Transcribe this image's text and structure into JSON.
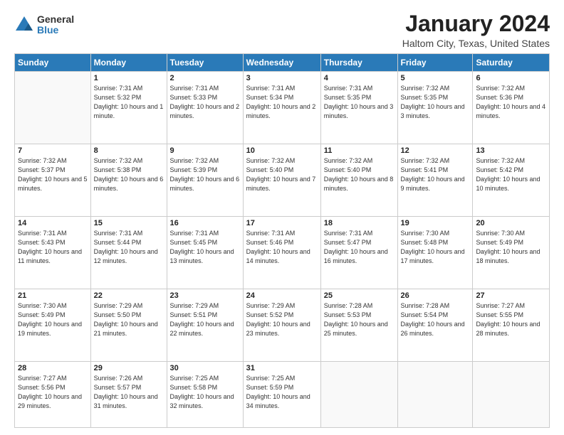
{
  "logo": {
    "general": "General",
    "blue": "Blue"
  },
  "header": {
    "month": "January 2024",
    "location": "Haltom City, Texas, United States"
  },
  "days_of_week": [
    "Sunday",
    "Monday",
    "Tuesday",
    "Wednesday",
    "Thursday",
    "Friday",
    "Saturday"
  ],
  "weeks": [
    [
      {
        "day": "",
        "info": ""
      },
      {
        "day": "1",
        "info": "Sunrise: 7:31 AM\nSunset: 5:32 PM\nDaylight: 10 hours\nand 1 minute."
      },
      {
        "day": "2",
        "info": "Sunrise: 7:31 AM\nSunset: 5:33 PM\nDaylight: 10 hours\nand 2 minutes."
      },
      {
        "day": "3",
        "info": "Sunrise: 7:31 AM\nSunset: 5:34 PM\nDaylight: 10 hours\nand 2 minutes."
      },
      {
        "day": "4",
        "info": "Sunrise: 7:31 AM\nSunset: 5:35 PM\nDaylight: 10 hours\nand 3 minutes."
      },
      {
        "day": "5",
        "info": "Sunrise: 7:32 AM\nSunset: 5:35 PM\nDaylight: 10 hours\nand 3 minutes."
      },
      {
        "day": "6",
        "info": "Sunrise: 7:32 AM\nSunset: 5:36 PM\nDaylight: 10 hours\nand 4 minutes."
      }
    ],
    [
      {
        "day": "7",
        "info": "Sunrise: 7:32 AM\nSunset: 5:37 PM\nDaylight: 10 hours\nand 5 minutes."
      },
      {
        "day": "8",
        "info": "Sunrise: 7:32 AM\nSunset: 5:38 PM\nDaylight: 10 hours\nand 6 minutes."
      },
      {
        "day": "9",
        "info": "Sunrise: 7:32 AM\nSunset: 5:39 PM\nDaylight: 10 hours\nand 6 minutes."
      },
      {
        "day": "10",
        "info": "Sunrise: 7:32 AM\nSunset: 5:40 PM\nDaylight: 10 hours\nand 7 minutes."
      },
      {
        "day": "11",
        "info": "Sunrise: 7:32 AM\nSunset: 5:40 PM\nDaylight: 10 hours\nand 8 minutes."
      },
      {
        "day": "12",
        "info": "Sunrise: 7:32 AM\nSunset: 5:41 PM\nDaylight: 10 hours\nand 9 minutes."
      },
      {
        "day": "13",
        "info": "Sunrise: 7:32 AM\nSunset: 5:42 PM\nDaylight: 10 hours\nand 10 minutes."
      }
    ],
    [
      {
        "day": "14",
        "info": "Sunrise: 7:31 AM\nSunset: 5:43 PM\nDaylight: 10 hours\nand 11 minutes."
      },
      {
        "day": "15",
        "info": "Sunrise: 7:31 AM\nSunset: 5:44 PM\nDaylight: 10 hours\nand 12 minutes."
      },
      {
        "day": "16",
        "info": "Sunrise: 7:31 AM\nSunset: 5:45 PM\nDaylight: 10 hours\nand 13 minutes."
      },
      {
        "day": "17",
        "info": "Sunrise: 7:31 AM\nSunset: 5:46 PM\nDaylight: 10 hours\nand 14 minutes."
      },
      {
        "day": "18",
        "info": "Sunrise: 7:31 AM\nSunset: 5:47 PM\nDaylight: 10 hours\nand 16 minutes."
      },
      {
        "day": "19",
        "info": "Sunrise: 7:30 AM\nSunset: 5:48 PM\nDaylight: 10 hours\nand 17 minutes."
      },
      {
        "day": "20",
        "info": "Sunrise: 7:30 AM\nSunset: 5:49 PM\nDaylight: 10 hours\nand 18 minutes."
      }
    ],
    [
      {
        "day": "21",
        "info": "Sunrise: 7:30 AM\nSunset: 5:49 PM\nDaylight: 10 hours\nand 19 minutes."
      },
      {
        "day": "22",
        "info": "Sunrise: 7:29 AM\nSunset: 5:50 PM\nDaylight: 10 hours\nand 21 minutes."
      },
      {
        "day": "23",
        "info": "Sunrise: 7:29 AM\nSunset: 5:51 PM\nDaylight: 10 hours\nand 22 minutes."
      },
      {
        "day": "24",
        "info": "Sunrise: 7:29 AM\nSunset: 5:52 PM\nDaylight: 10 hours\nand 23 minutes."
      },
      {
        "day": "25",
        "info": "Sunrise: 7:28 AM\nSunset: 5:53 PM\nDaylight: 10 hours\nand 25 minutes."
      },
      {
        "day": "26",
        "info": "Sunrise: 7:28 AM\nSunset: 5:54 PM\nDaylight: 10 hours\nand 26 minutes."
      },
      {
        "day": "27",
        "info": "Sunrise: 7:27 AM\nSunset: 5:55 PM\nDaylight: 10 hours\nand 28 minutes."
      }
    ],
    [
      {
        "day": "28",
        "info": "Sunrise: 7:27 AM\nSunset: 5:56 PM\nDaylight: 10 hours\nand 29 minutes."
      },
      {
        "day": "29",
        "info": "Sunrise: 7:26 AM\nSunset: 5:57 PM\nDaylight: 10 hours\nand 31 minutes."
      },
      {
        "day": "30",
        "info": "Sunrise: 7:25 AM\nSunset: 5:58 PM\nDaylight: 10 hours\nand 32 minutes."
      },
      {
        "day": "31",
        "info": "Sunrise: 7:25 AM\nSunset: 5:59 PM\nDaylight: 10 hours\nand 34 minutes."
      },
      {
        "day": "",
        "info": ""
      },
      {
        "day": "",
        "info": ""
      },
      {
        "day": "",
        "info": ""
      }
    ]
  ]
}
